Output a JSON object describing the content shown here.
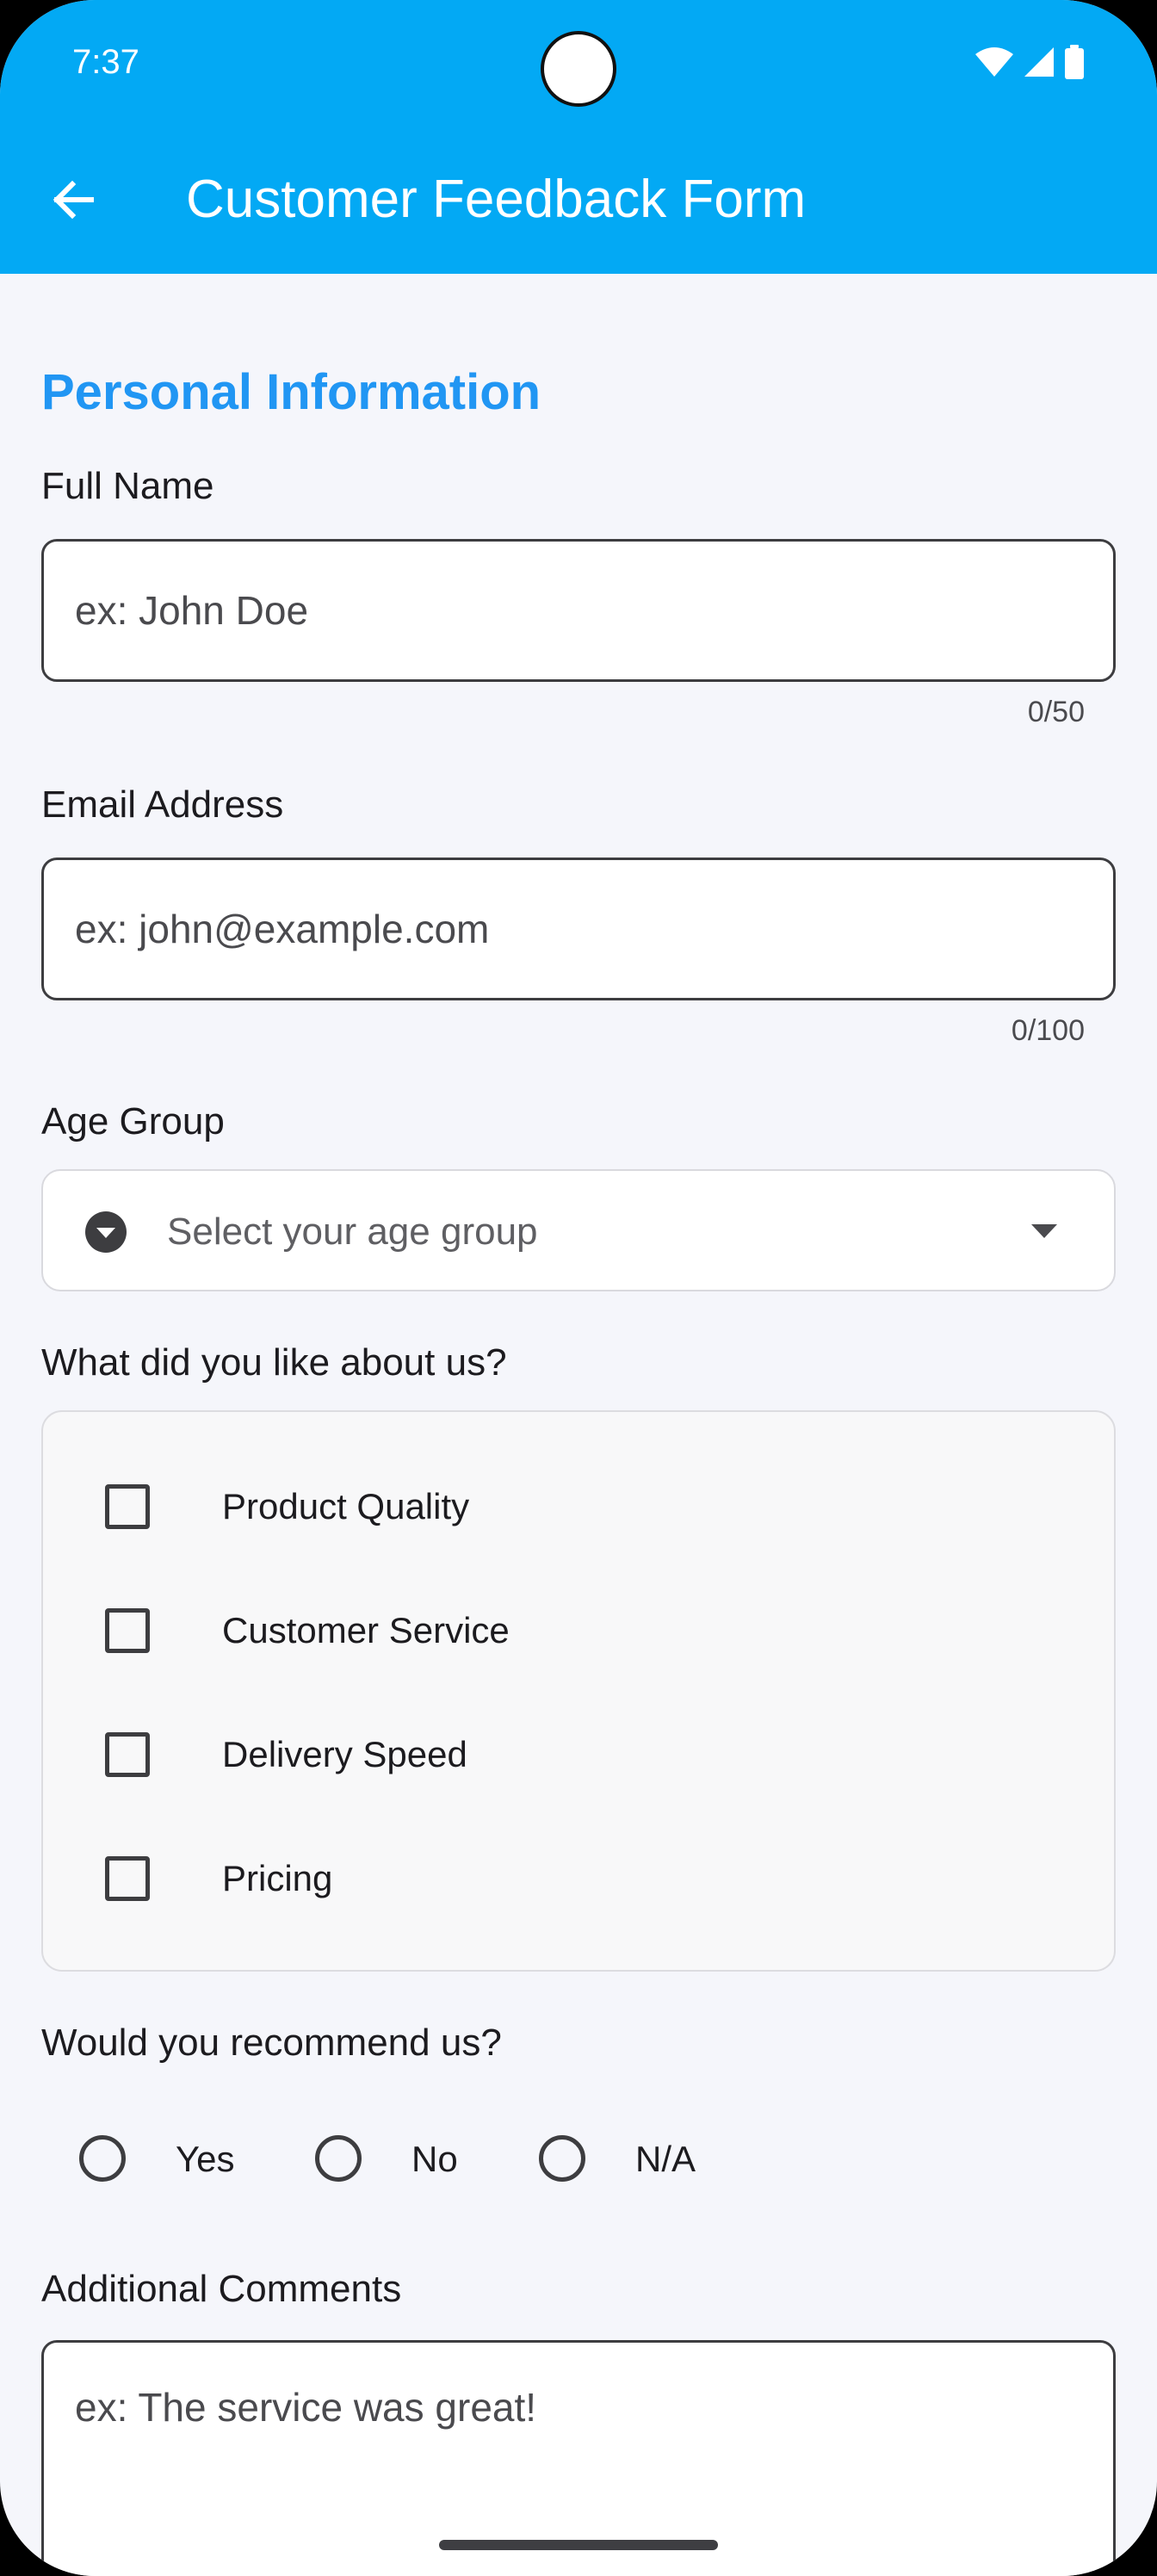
{
  "status_bar": {
    "time": "7:37"
  },
  "app_bar": {
    "title": "Customer Feedback Form"
  },
  "form": {
    "section_title": "Personal Information",
    "full_name": {
      "label": "Full Name",
      "placeholder": "ex: John Doe",
      "value": "",
      "counter": "0/50"
    },
    "email": {
      "label": "Email Address",
      "placeholder": "ex: john@example.com",
      "value": "",
      "counter": "0/100"
    },
    "age_group": {
      "label": "Age Group",
      "placeholder": "Select your age group"
    },
    "likes": {
      "label": "What did you like about us?",
      "options": [
        {
          "label": "Product Quality",
          "checked": false
        },
        {
          "label": "Customer Service",
          "checked": false
        },
        {
          "label": "Delivery Speed",
          "checked": false
        },
        {
          "label": "Pricing",
          "checked": false
        }
      ]
    },
    "recommend": {
      "label": "Would you recommend us?",
      "options": [
        {
          "label": "Yes",
          "selected": false
        },
        {
          "label": "No",
          "selected": false
        },
        {
          "label": "N/A",
          "selected": false
        }
      ]
    },
    "comments": {
      "label": "Additional Comments",
      "placeholder": "ex: The service was great!",
      "value": ""
    }
  },
  "colors": {
    "app_bar": "#03A9F4",
    "section_title": "#2196F3",
    "background": "#F5F6FB",
    "border": "#3D3D40"
  },
  "icons": {
    "back": "arrow-left-icon",
    "dropdown_leading": "circle-chevron-down-icon",
    "dropdown_trailing": "caret-down-icon",
    "status": [
      "wifi-icon",
      "cellular-signal-icon",
      "battery-icon"
    ]
  }
}
